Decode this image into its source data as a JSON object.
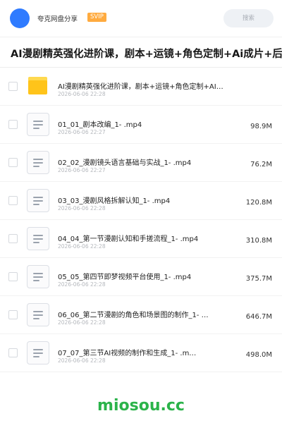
{
  "header": {
    "username": "夸克网盘分享",
    "badge": "SVIP",
    "search_placeholder": "搜索"
  },
  "title": "AI漫剧精英强化进阶课，剧本+运镜+角色定制+Ai成片+后期",
  "files": [
    {
      "type": "folder",
      "name": "AI漫剧精英强化进阶课，剧本+运镜+角色定制+AI…",
      "date": "2026-06-06 22:28",
      "size": ""
    },
    {
      "type": "file",
      "name": "01_01_剧本改编_1- .mp4",
      "date": "2026-06-06 22:27",
      "size": "98.9M"
    },
    {
      "type": "file",
      "name": "02_02_漫剧镜头语言基础与实战_1- .mp4",
      "date": "2026-06-06 22:27",
      "size": "76.2M"
    },
    {
      "type": "file",
      "name": "03_03_漫剧风格拆解认知_1- .mp4",
      "date": "2026-06-06 22:28",
      "size": "120.8M"
    },
    {
      "type": "file",
      "name": "04_04_第一节漫剧认知和手搓流程_1- .mp4",
      "date": "2026-06-06 22:28",
      "size": "310.8M"
    },
    {
      "type": "file",
      "name": "05_05_第四节即梦视频平台使用_1- .mp4",
      "date": "2026-06-06 22:28",
      "size": "375.7M"
    },
    {
      "type": "file",
      "name": "06_06_第二节漫剧的角色和场景图的制作_1- …",
      "date": "2026-06-06 22:28",
      "size": "646.7M"
    },
    {
      "type": "file",
      "name": "07_07_第三节AI视频的制作和生成_1- .m…",
      "date": "2026-06-06 22:28",
      "size": "498.0M"
    }
  ],
  "watermark": "miosou.cc"
}
